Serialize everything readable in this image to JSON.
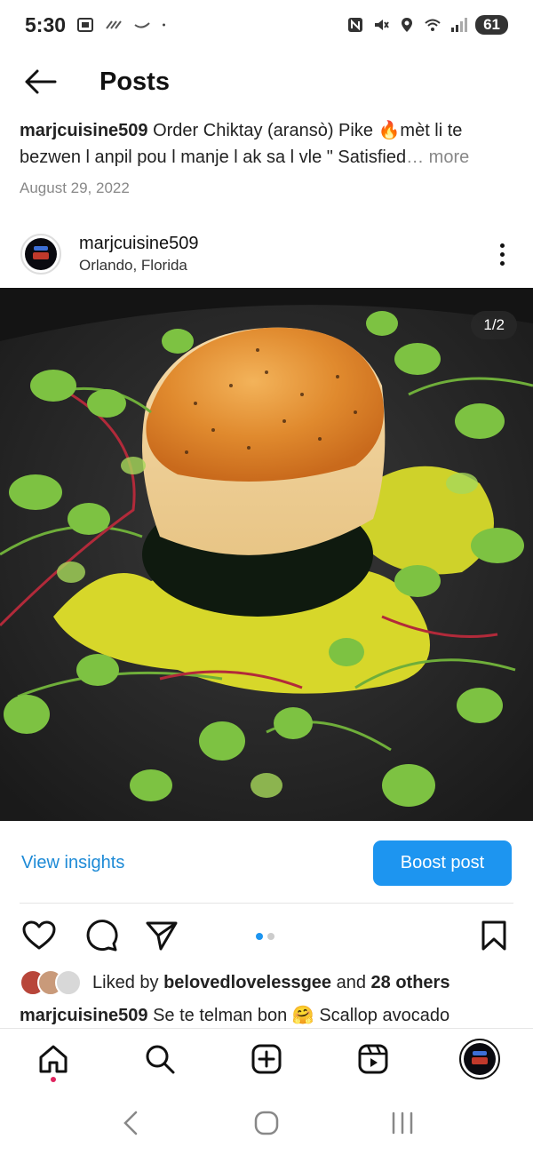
{
  "status_bar": {
    "time": "5:30",
    "battery": "61"
  },
  "header": {
    "title": "Posts"
  },
  "caption_top": {
    "username": "marjcuisine509",
    "text": "Order Chiktay (aransò) Pike 🔥mèt li te bezwen l anpil pou l manje l ak sa l vle \" Satisfied",
    "more": "… more"
  },
  "post": {
    "date": "August 29, 2022",
    "username": "marjcuisine509",
    "location": "Orlando, Florida",
    "counter": "1/2"
  },
  "insights": {
    "view_label": "View insights",
    "boost_label": "Boost post"
  },
  "likes": {
    "prefix": "Liked by ",
    "user": "belovedlovelessgee",
    "middle": " and ",
    "others": "28 others"
  },
  "caption_bottom": {
    "username": "marjcuisine509",
    "text": "Se te telman bon 🤗 Scallop avocado"
  },
  "colors": {
    "accent": "#1d95f0",
    "link": "#1d8ad6",
    "notify": "#e0245e"
  }
}
